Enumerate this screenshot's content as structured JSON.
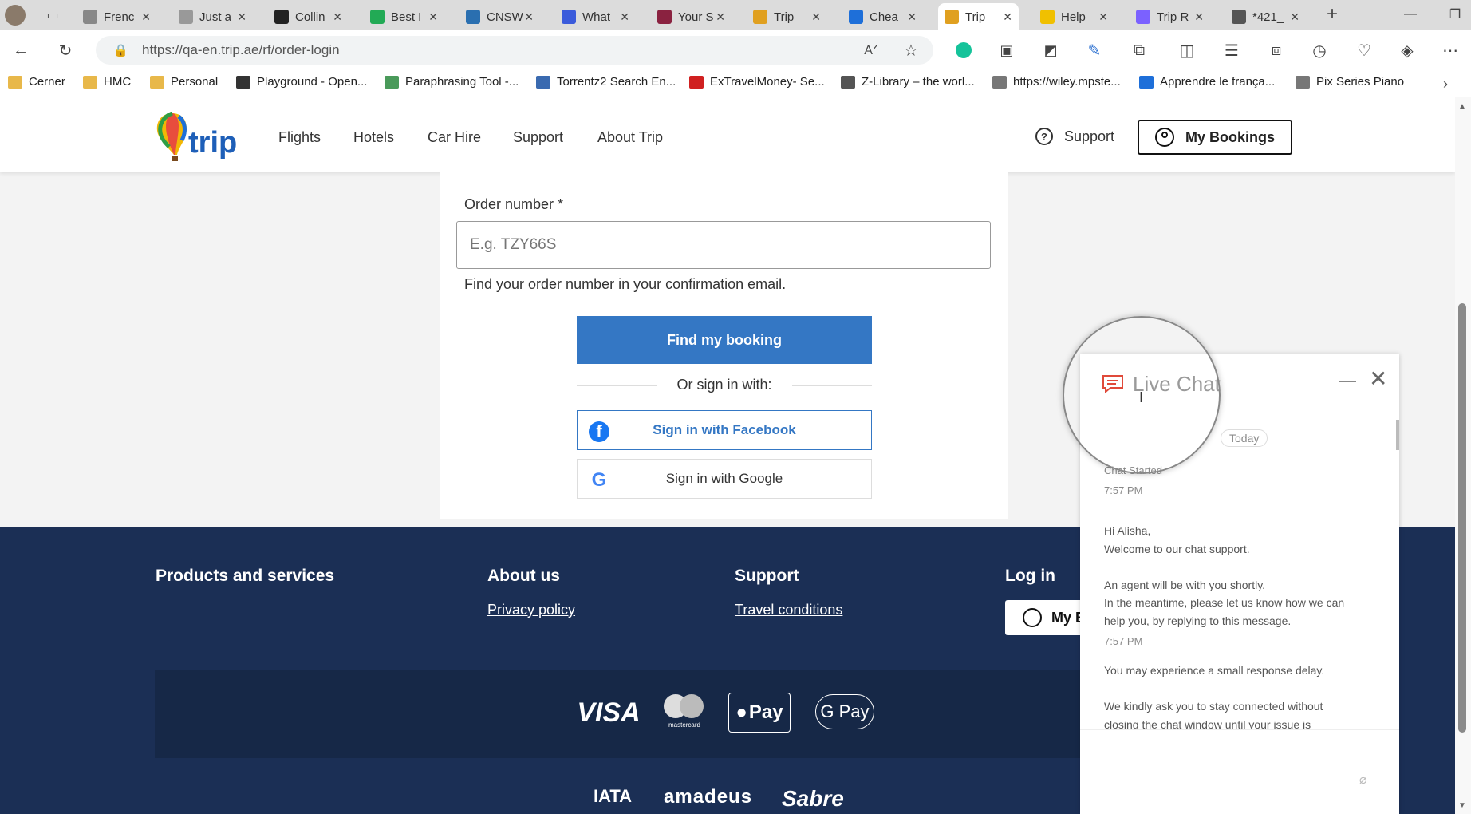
{
  "browser": {
    "tabs": [
      {
        "label": "Frenc",
        "color": "#888"
      },
      {
        "label": "Just a",
        "color": "#999"
      },
      {
        "label": "Collin",
        "color": "#222"
      },
      {
        "label": "Best I",
        "color": "#2a5"
      },
      {
        "label": "CNSW",
        "color": "#2a6fb0"
      },
      {
        "label": "What",
        "color": "#3b5bdb"
      },
      {
        "label": "Your S",
        "color": "#8a2240"
      },
      {
        "label": "Trip",
        "color": "#e0a020"
      },
      {
        "label": "Chea",
        "color": "#1e6fd9"
      },
      {
        "label": "Trip",
        "color": "#e0a020"
      },
      {
        "label": "Help",
        "color": "#f0c000"
      },
      {
        "label": "Trip R",
        "color": "#7b61ff"
      },
      {
        "label": "*421_",
        "color": "#555"
      }
    ],
    "active_tab_index": 9,
    "url": "https://qa-en.trip.ae/rf/order-login",
    "bookmarks": [
      {
        "label": "Cerner",
        "color": "#e8b84a"
      },
      {
        "label": "HMC",
        "color": "#e8b84a"
      },
      {
        "label": "Personal",
        "color": "#e8b84a"
      },
      {
        "label": "Playground - Open...",
        "color": "#333"
      },
      {
        "label": "Paraphrasing Tool -...",
        "color": "#4a9a5a"
      },
      {
        "label": "Torrentz2 Search En...",
        "color": "#3a6ab0"
      },
      {
        "label": "ExTravelMoney- Se...",
        "color": "#d02020"
      },
      {
        "label": "Z-Library – the worl...",
        "color": "#555"
      },
      {
        "label": "https://wiley.mpste...",
        "color": "#777"
      },
      {
        "label": "Apprendre le frança...",
        "color": "#1e6fd9"
      },
      {
        "label": "Pix Series Piano",
        "color": "#777"
      }
    ]
  },
  "header": {
    "logo_text": "trip",
    "nav": [
      "Flights",
      "Hotels",
      "Car Hire",
      "Support",
      "About Trip"
    ],
    "support_label": "Support",
    "my_bookings_label": "My Bookings"
  },
  "form": {
    "order_label": "Order number *",
    "order_placeholder": "E.g. TZY66S",
    "hint": "Find your order number in your confirmation email.",
    "find_button": "Find my booking",
    "or_sign_in": "Or sign in with:",
    "facebook_button": "Sign in with Facebook",
    "google_button": "Sign in with Google"
  },
  "footer": {
    "headings": [
      "Products and services",
      "About us",
      "Support",
      "Log in"
    ],
    "privacy_link": "Privacy policy",
    "travel_link": "Travel conditions",
    "my_button": "My B",
    "payments": [
      "VISA",
      "mastercard",
      "Pay",
      "G Pay"
    ],
    "partners": [
      "IATA",
      "amadeus",
      "Sabre"
    ]
  },
  "chat": {
    "title": "Live Chat",
    "day_label": "Today",
    "started": "Chat Started",
    "time": "7:57 PM",
    "messages": [
      "Hi Alisha,",
      "Welcome to our chat support.",
      "An agent will be with you shortly.",
      "In the meantime, please let us know how we can",
      "help you, by replying to this message.",
      "You may experience a small response delay.",
      "We kindly ask you to stay connected without",
      "closing the chat window until your issue is"
    ]
  },
  "colors": {
    "primary_blue": "#3477c4",
    "footer_navy": "#1b2f55",
    "chat_icon_red": "#e04a3a"
  }
}
